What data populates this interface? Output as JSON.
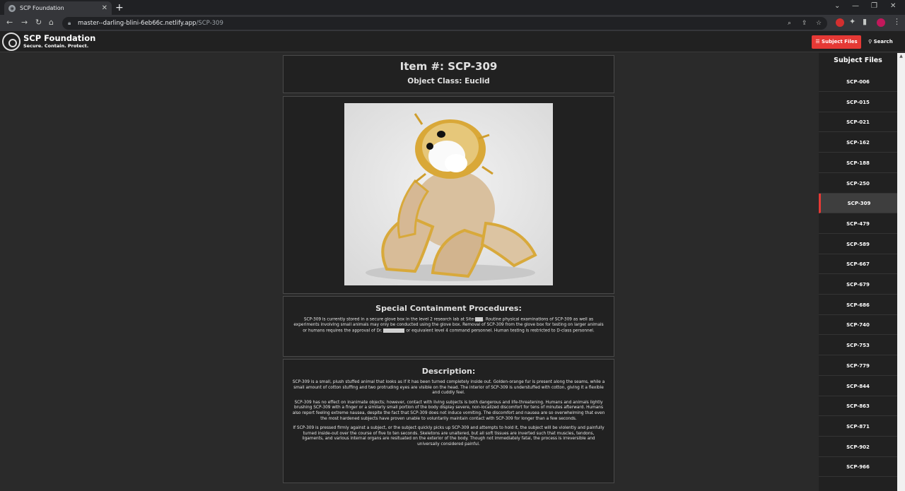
{
  "browser": {
    "tab_title": "SCP Foundation",
    "url_host": "master--darling-blini-6eb66c.netlify.app",
    "url_path": "/SCP-309"
  },
  "header": {
    "brand": "SCP Foundation",
    "tagline": "Secure. Contain. Protect.",
    "subject_files_button": "Subject Files",
    "search_button": "Search"
  },
  "item": {
    "title": "Item #: SCP-309",
    "object_class": "Object Class: Euclid"
  },
  "containment": {
    "heading": "Special Containment Procedures:",
    "p1_a": "SCP-309 is currently stored in a secure glove box in the level 2 research lab at Site-",
    "p1_b": ". Routine physical examinations of SCP-309 as well as experiments involving small animals may only be conducted using the glove box. Removal of SCP-309 from the glove box for testing on larger animals or humans requires the approval of Dr.",
    "p1_c": "or equivalent level 4 command personnel. Human testing is restricted to D-class personnel."
  },
  "description": {
    "heading": "Description:",
    "p1": "SCP-309 is a small, plush stuffed animal that looks as if it has been turned completely inside out. Golden-orange fur is present along the seams, while a small amount of cotton stuffing and two protruding eyes are visible on the head. The interior of SCP-309 is understuffed with cotton, giving it a flexible and cuddly feel.",
    "p2": "SCP-309 has no effect on inanimate objects; however, contact with living subjects is both dangerous and life-threatening. Humans and animals lightly brushing SCP-309 with a finger or a similarly small portion of the body display severe, non-localized discomfort for tens of minutes afterward. Humans also report feeling extreme nausea, despite the fact that SCP-309 does not induce vomiting. The discomfort and nausea are so overwhelming that even the most hardened subjects have proven unable to voluntarily maintain contact with SCP-309 for longer than a few seconds.",
    "p3": "If SCP-309 is pressed firmly against a subject, or the subject quickly picks up SCP-309 and attempts to hold it, the subject will be violently and painfully turned inside-out over the course of five to ten seconds. Skeletons are unaltered, but all soft tissues are inverted such that muscles, tendons, ligaments, and various internal organs are resituated on the exterior of the body. Though not immediately fatal, the process is irreversible and universally considered painful."
  },
  "sidebar": {
    "heading": "Subject Files",
    "active": "SCP-309",
    "items": [
      "SCP-006",
      "SCP-015",
      "SCP-021",
      "SCP-162",
      "SCP-188",
      "SCP-250",
      "SCP-309",
      "SCP-479",
      "SCP-589",
      "SCP-667",
      "SCP-679",
      "SCP-686",
      "SCP-740",
      "SCP-753",
      "SCP-779",
      "SCP-844",
      "SCP-863",
      "SCP-871",
      "SCP-902",
      "SCP-966"
    ]
  },
  "colors": {
    "accent": "#e53935",
    "background": "#2a2a2a",
    "panel": "#212121"
  }
}
